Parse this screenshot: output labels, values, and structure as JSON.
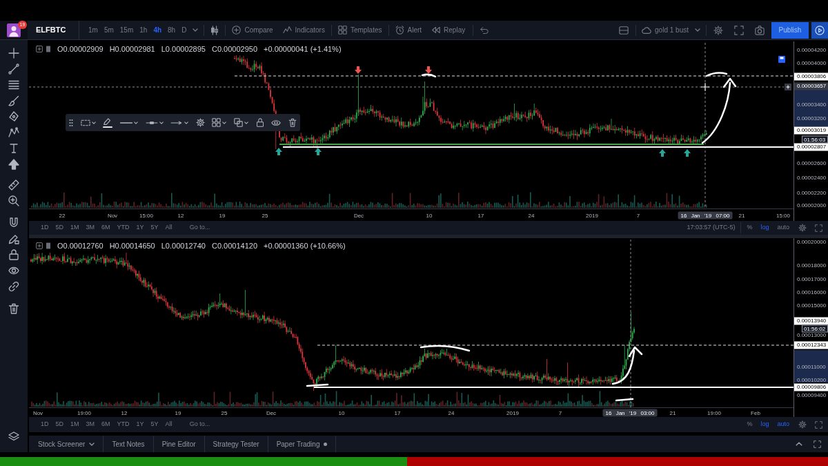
{
  "toolbar": {
    "avatar_badge": "19",
    "symbol": "ELFBTC",
    "intervals": [
      {
        "label": "1m",
        "selected": false
      },
      {
        "label": "5m",
        "selected": false
      },
      {
        "label": "15m",
        "selected": false
      },
      {
        "label": "1h",
        "selected": false
      },
      {
        "label": "4h",
        "selected": true
      },
      {
        "label": "8h",
        "selected": false
      },
      {
        "label": "D",
        "selected": false
      }
    ],
    "actions": [
      {
        "kind": "compare",
        "label": "Compare"
      },
      {
        "kind": "indicators",
        "label": "Indicators"
      },
      {
        "kind": "templates",
        "label": "Templates"
      },
      {
        "kind": "alert",
        "label": "Alert"
      },
      {
        "kind": "replay",
        "label": "Replay"
      }
    ],
    "layout_name": "gold 1 bust",
    "publish": "Publish"
  },
  "panes": [
    {
      "legend": {
        "fields": [
          "O0.00002909",
          "H0.00002981",
          "L0.00002895",
          "C0.00002950"
        ],
        "change": "+0.00000041 (+1.41%)"
      },
      "price_axis": [
        {
          "kind": "tick",
          "text": "0.00004200"
        },
        {
          "kind": "tick",
          "text": "0.00004000"
        },
        {
          "kind": "line",
          "text": "0.00003806"
        },
        {
          "kind": "crosshair",
          "text": "0.00003657"
        },
        {
          "kind": "tick",
          "text": "0.00003400"
        },
        {
          "kind": "tick",
          "text": "0.00003200"
        },
        {
          "kind": "line",
          "text": "0.00003019"
        },
        {
          "kind": "countdown",
          "text": "01:56:03"
        },
        {
          "kind": "line",
          "text": "0.00002807"
        },
        {
          "kind": "tick",
          "text": "0.00002600"
        },
        {
          "kind": "tick",
          "text": "0.00002400"
        },
        {
          "kind": "tick",
          "text": "0.00002200"
        },
        {
          "kind": "tick",
          "text": "0.00002000"
        }
      ],
      "time_axis": [
        {
          "kind": "tick",
          "text": "22"
        },
        {
          "kind": "tick",
          "text": "Nov"
        },
        {
          "kind": "tick",
          "text": "15:00"
        },
        {
          "kind": "tick",
          "text": "12"
        },
        {
          "kind": "tick",
          "text": "19"
        },
        {
          "kind": "tick",
          "text": "25"
        },
        {
          "kind": "tick",
          "text": "Dec"
        },
        {
          "kind": "tick",
          "text": "10"
        },
        {
          "kind": "tick",
          "text": "17"
        },
        {
          "kind": "tick",
          "text": "24"
        },
        {
          "kind": "tick",
          "text": "2019"
        },
        {
          "kind": "tick",
          "text": "7"
        },
        {
          "kind": "crosshair",
          "text": "16 Jan '19 07:00"
        },
        {
          "kind": "tick",
          "text": "21"
        },
        {
          "kind": "tick",
          "text": "15:00"
        }
      ],
      "ranges": [
        "1D",
        "5D",
        "1M",
        "3M",
        "6M",
        "YTD",
        "1Y",
        "5Y",
        "All"
      ],
      "goto": "Go to...",
      "clock": "17:03:57 (UTC-5)",
      "scale_options": [
        {
          "label": "%",
          "on": false
        },
        {
          "label": "log",
          "on": true
        },
        {
          "label": "auto",
          "on": false
        }
      ]
    },
    {
      "legend": {
        "fields": [
          "O0.00012760",
          "H0.00014650",
          "L0.00012740",
          "C0.00014120"
        ],
        "change": "+0.00001360 (+10.66%)"
      },
      "price_axis": [
        {
          "kind": "tick",
          "text": "0.00020000"
        },
        {
          "kind": "tick",
          "text": "0.00018000"
        },
        {
          "kind": "tick",
          "text": "0.00017000"
        },
        {
          "kind": "tick",
          "text": "0.00016000"
        },
        {
          "kind": "tick",
          "text": "0.00015000"
        },
        {
          "kind": "line",
          "text": "0.00013940"
        },
        {
          "kind": "countdown",
          "text": "01:56:02"
        },
        {
          "kind": "tick",
          "text": "0.00013000"
        },
        {
          "kind": "line",
          "text": "0.00012343"
        },
        {
          "kind": "tick",
          "text": "0.00011000"
        },
        {
          "kind": "tick",
          "text": "0.00010200"
        },
        {
          "kind": "line",
          "text": "0.00009806"
        },
        {
          "kind": "tick",
          "text": "0.00009400"
        }
      ],
      "time_axis": [
        {
          "kind": "tick",
          "text": "Nov"
        },
        {
          "kind": "tick",
          "text": "19:00"
        },
        {
          "kind": "tick",
          "text": "12"
        },
        {
          "kind": "tick",
          "text": "19"
        },
        {
          "kind": "tick",
          "text": "25"
        },
        {
          "kind": "tick",
          "text": "Dec"
        },
        {
          "kind": "tick",
          "text": "10"
        },
        {
          "kind": "tick",
          "text": "17"
        },
        {
          "kind": "tick",
          "text": "24"
        },
        {
          "kind": "tick",
          "text": "2019"
        },
        {
          "kind": "tick",
          "text": "7"
        },
        {
          "kind": "crosshair",
          "text": "16 Jan '19 03:00"
        },
        {
          "kind": "tick",
          "text": "21"
        },
        {
          "kind": "tick",
          "text": "19:00"
        },
        {
          "kind": "tick",
          "text": "Feb"
        }
      ],
      "ranges": [
        "1D",
        "5D",
        "1M",
        "3M",
        "6M",
        "YTD",
        "1Y",
        "5Y",
        "All"
      ],
      "goto": "Go to...",
      "scale_options": [
        {
          "label": "%",
          "on": false
        },
        {
          "label": "log",
          "on": true
        },
        {
          "label": "auto",
          "on": true
        }
      ]
    }
  ],
  "bottom_panel": {
    "tabs": [
      {
        "label": "Stock Screener",
        "kind": "dropdown",
        "selected": false
      },
      {
        "label": "Text Notes",
        "kind": "plain",
        "selected": false
      },
      {
        "label": "Pine Editor",
        "kind": "plain",
        "selected": false
      },
      {
        "label": "Strategy Tester",
        "kind": "plain",
        "selected": false
      },
      {
        "label": "Paper Trading",
        "kind": "status",
        "selected": false
      }
    ]
  }
}
